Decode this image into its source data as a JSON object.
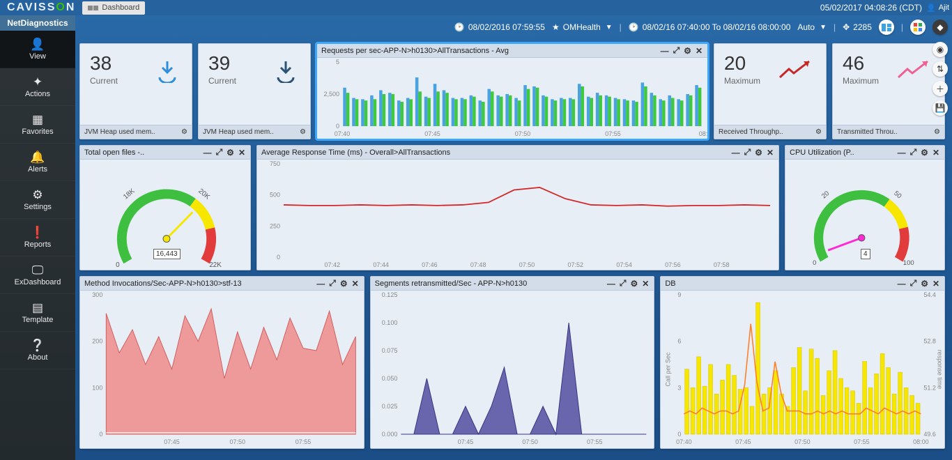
{
  "header": {
    "logo_left": "CAVISS",
    "logo_right": "N",
    "dashboard_tab": "Dashboard",
    "datetime": "05/02/2017 04:08:26 (CDT)",
    "user": "Ajit"
  },
  "infobar": {
    "snapshot_time": "08/02/2016 07:59:55",
    "favorite": "OMHealth",
    "range": "08/02/16 07:40:00 To 08/02/16 08:00:00",
    "mode": "Auto",
    "counter": "2285"
  },
  "sidebar": {
    "product": "NetDiagnostics",
    "items": [
      {
        "icon": "person",
        "label": "View"
      },
      {
        "icon": "puzzle",
        "label": "Actions"
      },
      {
        "icon": "grid",
        "label": "Favorites"
      },
      {
        "icon": "bell",
        "label": "Alerts"
      },
      {
        "icon": "gear",
        "label": "Settings"
      },
      {
        "icon": "alert",
        "label": "Reports"
      },
      {
        "icon": "screen",
        "label": "ExDashboard"
      },
      {
        "icon": "doc",
        "label": "Template"
      },
      {
        "icon": "question",
        "label": "About"
      }
    ]
  },
  "panels": {
    "kpi1": {
      "value": "38",
      "label": "Current",
      "footer": "JVM Heap used mem.."
    },
    "kpi2": {
      "value": "39",
      "label": "Current",
      "footer": "JVM Heap used mem.."
    },
    "reqps": {
      "title": "Requests per sec-APP-N>h0130>AllTransactions - Avg"
    },
    "kpi3": {
      "value": "20",
      "label": "Maximum",
      "footer": "Received Throughp.."
    },
    "kpi4": {
      "value": "46",
      "label": "Maximum",
      "footer": "Transmitted Throu.."
    },
    "openfiles": {
      "title": "Total open files -..",
      "value": "16,443"
    },
    "avgresp": {
      "title": "Average Response Time (ms) - Overall>AllTransactions"
    },
    "cpu": {
      "title": "CPU Utilization (P..",
      "value": "4"
    },
    "method": {
      "title": "Method Invocations/Sec-APP-N>h0130>stf-13"
    },
    "seg": {
      "title": "Segments retransmitted/Sec - APP-N>h0130"
    },
    "db": {
      "title": "DB",
      "ylabel_left": "Call per Sec",
      "ylabel_right": "response time"
    }
  },
  "chart_data": [
    {
      "id": "reqps",
      "type": "bar",
      "x_ticks": [
        "07:40",
        "07:45",
        "07:50",
        "07:55",
        "08:"
      ],
      "y_ticks": [
        0,
        2500,
        5
      ],
      "ylim": [
        0,
        5000
      ],
      "categories": [
        "07:40.0",
        "07:40.5",
        "07:41.0",
        "07:41.5",
        "07:42.0",
        "07:42.5",
        "07:43.0",
        "07:43.5",
        "07:44.0",
        "07:44.5",
        "07:45.0",
        "07:45.5",
        "07:46.0",
        "07:46.5",
        "07:47.0",
        "07:47.5",
        "07:48.0",
        "07:48.5",
        "07:49.0",
        "07:49.5",
        "07:50.0",
        "07:50.5",
        "07:51.0",
        "07:51.5",
        "07:52.0",
        "07:52.5",
        "07:53.0",
        "07:53.5",
        "07:54.0",
        "07:54.5",
        "07:55.0",
        "07:55.5",
        "07:56.0",
        "07:56.5",
        "07:57.0",
        "07:57.5",
        "07:58.0",
        "07:58.5",
        "07:59.0",
        "07:59.5"
      ],
      "series": [
        {
          "name": "seriesA",
          "color": "#4aa2e0",
          "values": [
            3000,
            2200,
            2100,
            2400,
            2800,
            2600,
            2000,
            2200,
            3800,
            2300,
            3300,
            2800,
            2200,
            2200,
            2400,
            2000,
            2900,
            2400,
            2500,
            2200,
            3200,
            3100,
            2400,
            2100,
            2200,
            2200,
            3300,
            2300,
            2600,
            2400,
            2200,
            2100,
            2000,
            3400,
            2600,
            2100,
            2400,
            2100,
            2500,
            3200
          ]
        },
        {
          "name": "seriesB",
          "color": "#3ec93e",
          "values": [
            2600,
            2100,
            2000,
            2100,
            2500,
            2500,
            1900,
            2100,
            2700,
            2200,
            2700,
            2600,
            2100,
            2100,
            2300,
            1900,
            2700,
            2300,
            2400,
            2000,
            2900,
            3000,
            2300,
            2000,
            2100,
            2100,
            3100,
            2200,
            2400,
            2300,
            2100,
            2000,
            1900,
            3100,
            2400,
            2000,
            2200,
            2000,
            2400,
            3000
          ]
        }
      ]
    },
    {
      "id": "openfiles",
      "type": "gauge",
      "min": 0,
      "max": 24000,
      "value": 16443,
      "ticks": [
        "0",
        "18K",
        "20K",
        "22K"
      ]
    },
    {
      "id": "avgresp",
      "type": "line",
      "x_ticks": [
        "07:42",
        "07:44",
        "07:46",
        "07:48",
        "07:50",
        "07:52",
        "07:54",
        "07:56",
        "07:58"
      ],
      "y_ticks": [
        0,
        250,
        500,
        750
      ],
      "ylim": [
        0,
        750
      ],
      "series": [
        {
          "name": "resp",
          "color": "#d62728",
          "x": [
            "07:40",
            "07:41",
            "07:42",
            "07:43",
            "07:44",
            "07:45",
            "07:46",
            "07:47",
            "07:48",
            "07:49",
            "07:50",
            "07:51",
            "07:52",
            "07:53",
            "07:54",
            "07:55",
            "07:56",
            "07:57",
            "07:58",
            "07:59"
          ],
          "values": [
            420,
            415,
            415,
            420,
            415,
            420,
            415,
            420,
            440,
            540,
            560,
            470,
            420,
            415,
            420,
            410,
            415,
            415,
            420,
            415
          ]
        }
      ]
    },
    {
      "id": "cpu",
      "type": "gauge",
      "min": 0,
      "max": 100,
      "value": 4,
      "ticks": [
        "0",
        "20",
        "50",
        "100"
      ]
    },
    {
      "id": "method",
      "type": "area",
      "x_ticks": [
        "07:45",
        "07:50",
        "07:55"
      ],
      "y_ticks": [
        0,
        100,
        200,
        300
      ],
      "ylim": [
        0,
        300
      ],
      "series": [
        {
          "name": "inv",
          "color": "#ef8b8b",
          "x": [
            "07:40",
            "07:41",
            "07:42",
            "07:43",
            "07:44",
            "07:45",
            "07:46",
            "07:47",
            "07:48",
            "07:49",
            "07:50",
            "07:51",
            "07:52",
            "07:53",
            "07:54",
            "07:55",
            "07:56",
            "07:57",
            "07:58",
            "07:59"
          ],
          "values": [
            260,
            175,
            225,
            150,
            210,
            140,
            255,
            200,
            270,
            120,
            220,
            140,
            230,
            160,
            250,
            185,
            180,
            265,
            150,
            210
          ]
        }
      ]
    },
    {
      "id": "seg",
      "type": "area",
      "x_ticks": [
        "07:45",
        "07:50",
        "07:55"
      ],
      "y_ticks": [
        0,
        0.025,
        0.05,
        0.075,
        0.1,
        0.125
      ],
      "ylim": [
        0,
        0.125
      ],
      "series": [
        {
          "name": "seg",
          "color": "#5c57a6",
          "x": [
            "07:40",
            "07:41",
            "07:42",
            "07:43",
            "07:44",
            "07:45",
            "07:46",
            "07:47",
            "07:48",
            "07:49",
            "07:50",
            "07:51",
            "07:52",
            "07:53",
            "07:54",
            "07:55",
            "07:56",
            "07:57",
            "07:58",
            "07:59"
          ],
          "values": [
            0,
            0,
            0.05,
            0,
            0,
            0.025,
            0,
            0.025,
            0.06,
            0,
            0,
            0.025,
            0,
            0.1,
            0,
            0,
            0,
            0,
            0,
            0
          ]
        }
      ]
    },
    {
      "id": "db",
      "type": "bar",
      "x_ticks": [
        "07:40",
        "07:45",
        "07:50",
        "07:55",
        "08:00"
      ],
      "y_ticks_left": [
        0,
        3,
        6,
        9
      ],
      "y_ticks_right": [
        49.6,
        51.2,
        52.8,
        54.4
      ],
      "ylim_left": [
        0,
        9
      ],
      "ylim_right": [
        49.6,
        54.4
      ],
      "series": [
        {
          "name": "calls",
          "type": "bar",
          "color": "#f7e600",
          "axis": "left",
          "values": [
            4.2,
            3,
            5,
            3.1,
            4.5,
            2.6,
            3.5,
            4.5,
            3.8,
            2.9,
            3,
            1.8,
            8.5,
            2.6,
            3,
            4.1,
            2.6,
            1.8,
            4.3,
            5.6,
            2.8,
            5.5,
            4.9,
            2.5,
            4.1,
            5.4,
            3.6,
            3,
            2.8,
            2,
            4.7,
            3,
            3.9,
            5.2,
            4.3,
            2.6,
            4,
            3,
            2.5,
            2
          ]
        },
        {
          "name": "resp",
          "type": "line",
          "color": "#ff7f2a",
          "axis": "right",
          "values": [
            50.3,
            50.4,
            50.3,
            50.5,
            50.4,
            50.3,
            50.4,
            50.4,
            50.3,
            50.4,
            51.3,
            53.4,
            51.4,
            50.4,
            50.5,
            52.1,
            51.0,
            50.4,
            50.4,
            50.4,
            50.3,
            50.3,
            50.4,
            50.3,
            50.4,
            50.3,
            50.4,
            50.3,
            50.3,
            50.3,
            50.5,
            50.4,
            50.3,
            50.5,
            50.4,
            50.3,
            50.4,
            50.3,
            50.4,
            50.3
          ]
        }
      ]
    }
  ]
}
